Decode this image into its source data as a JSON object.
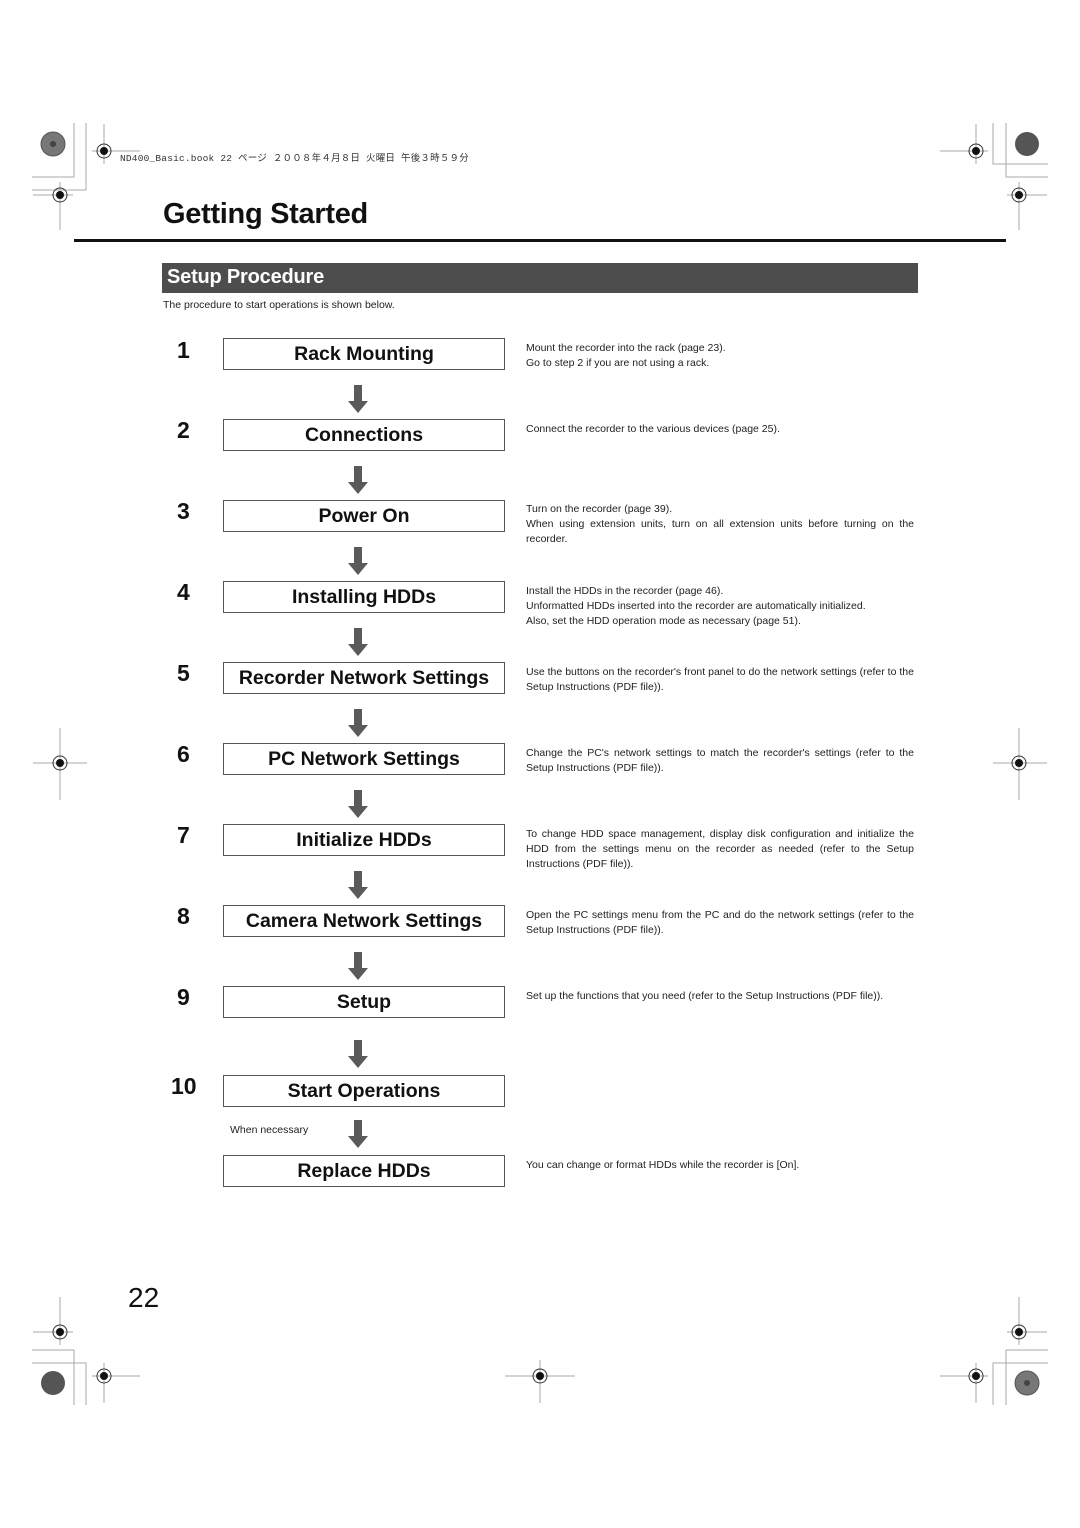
{
  "header": {
    "meta_line": "ND400_Basic.book  22 ページ  ２００８年４月８日  火曜日  午後３時５９分"
  },
  "page": {
    "title": "Getting Started",
    "number": "22"
  },
  "section": {
    "title": "Setup Procedure",
    "intro": "The procedure to start operations is shown below."
  },
  "steps": [
    {
      "number": "1",
      "label": "Rack Mounting",
      "description": [
        "Mount the recorder into the rack (page 23).",
        "Go to step 2 if you are not using a rack."
      ]
    },
    {
      "number": "2",
      "label": "Connections",
      "description": [
        "Connect the recorder to the various devices (page 25)."
      ]
    },
    {
      "number": "3",
      "label": "Power On",
      "description": [
        "Turn on the recorder (page 39).",
        "When using extension units, turn on all extension units before turning on the recorder."
      ]
    },
    {
      "number": "4",
      "label": "Installing HDDs",
      "description": [
        "Install the HDDs in the recorder (page 46).",
        "Unformatted HDDs inserted into the recorder are automatically initialized.",
        "Also, set the HDD operation mode as necessary (page 51)."
      ]
    },
    {
      "number": "5",
      "label": "Recorder Network Settings",
      "description": [
        "Use the buttons on the recorder's front panel to do the network settings (refer to the Setup Instructions (PDF file))."
      ]
    },
    {
      "number": "6",
      "label": "PC Network Settings",
      "description": [
        "Change the PC's network settings to match the recorder's settings (refer to the Setup Instructions (PDF file))."
      ]
    },
    {
      "number": "7",
      "label": "Initialize HDDs",
      "description": [
        "To change HDD space management, display disk configuration and initialize the HDD from the settings menu on the recorder as needed (refer to the Setup Instructions (PDF file))."
      ]
    },
    {
      "number": "8",
      "label": "Camera Network Settings",
      "description": [
        "Open the PC settings menu from the PC and do the network settings (refer to the Setup Instructions (PDF file))."
      ]
    },
    {
      "number": "9",
      "label": "Setup",
      "description": [
        "Set up the functions that you need (refer to the Setup Instructions (PDF file))."
      ]
    },
    {
      "number": "10",
      "label": "Start Operations",
      "description": []
    }
  ],
  "optional_step": {
    "condition_label": "When necessary",
    "label": "Replace HDDs",
    "description": [
      "You can change or format HDDs while the recorder is [On]."
    ]
  },
  "colors": {
    "section_bar": "#4d4d4d",
    "arrow": "#5a5a5a",
    "text": "#111111"
  }
}
